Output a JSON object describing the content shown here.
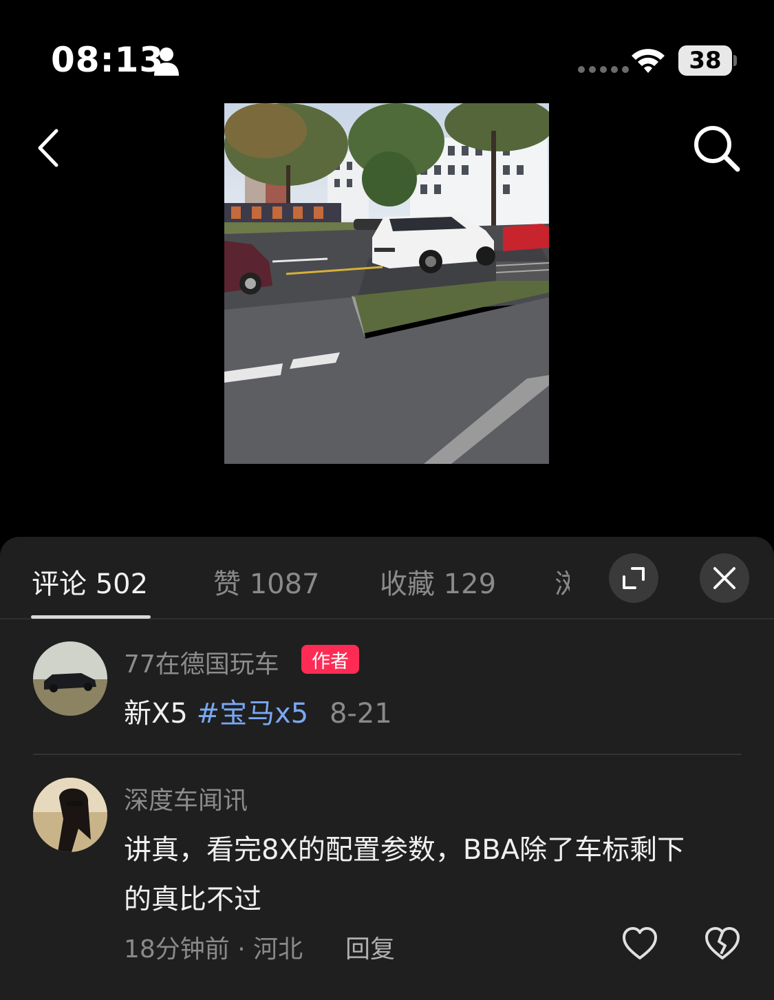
{
  "status_bar": {
    "time": "08:13",
    "battery": "38"
  },
  "tabs": [
    {
      "label": "评论 502",
      "active": true
    },
    {
      "label": "赞 1087",
      "active": false
    },
    {
      "label": "收藏 129",
      "active": false
    },
    {
      "label": "浏",
      "active": false
    }
  ],
  "comments": [
    {
      "username": "77在德国玩车",
      "badge": "作者",
      "text": "新X5",
      "hashtag": "#宝马x5",
      "date": "8-21"
    },
    {
      "username": "深度车闻讯",
      "text_line1": "讲真，看完8X的配置参数，BBA除了车标剩下",
      "text_line2": "的真比不过",
      "meta": "18分钟前 · 河北",
      "reply": "回复"
    }
  ],
  "icons": [
    "person-icon",
    "wifi-icon",
    "back-icon",
    "search-icon",
    "expand-icon",
    "close-icon",
    "heart-icon",
    "broken-heart-icon"
  ]
}
